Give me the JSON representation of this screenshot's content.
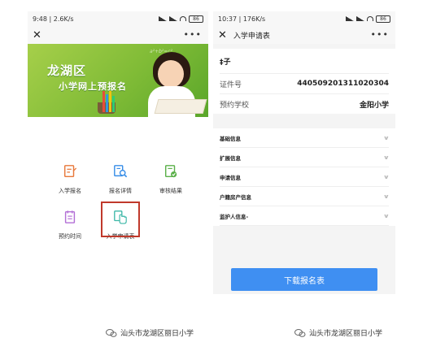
{
  "left_phone": {
    "status": {
      "time": "9:48",
      "speed": "2.6K/s",
      "battery": "86"
    },
    "banner": {
      "title_main": "龙湖区",
      "title_sub": "小学网上预报名",
      "formula": "a²+b²=c²"
    },
    "grid": [
      {
        "label": "入学报名",
        "icon": "edit-form-icon",
        "color": "#e8783a"
      },
      {
        "label": "报名详情",
        "icon": "search-document-icon",
        "color": "#3a8fe8"
      },
      {
        "label": "审核结果",
        "icon": "check-document-icon",
        "color": "#5bb04a"
      },
      {
        "label": "预约时间",
        "icon": "calendar-list-icon",
        "color": "#b36fd6"
      },
      {
        "label": "入学申请表",
        "icon": "hand-tap-icon",
        "color": "#3db8a8"
      }
    ],
    "highlight_color": "#c0392b"
  },
  "right_phone": {
    "status": {
      "time": "10:37",
      "speed": "176K/s",
      "battery": "86"
    },
    "nav_title": "入学申请表",
    "name": "‡子",
    "rows": [
      {
        "label": "证件号",
        "value": "440509201311020304"
      },
      {
        "label": "预约学校",
        "value": "金阳小学"
      }
    ],
    "sections": [
      "基础信息",
      "扩展信息",
      "申请信息",
      "户籍房产信息",
      "监护人信息-"
    ],
    "download_button": "下载报名表",
    "accent": "#3f8ff2"
  },
  "watermarks": [
    "汕头市龙湖区丽日小学",
    "汕头市龙湖区丽日小学"
  ]
}
